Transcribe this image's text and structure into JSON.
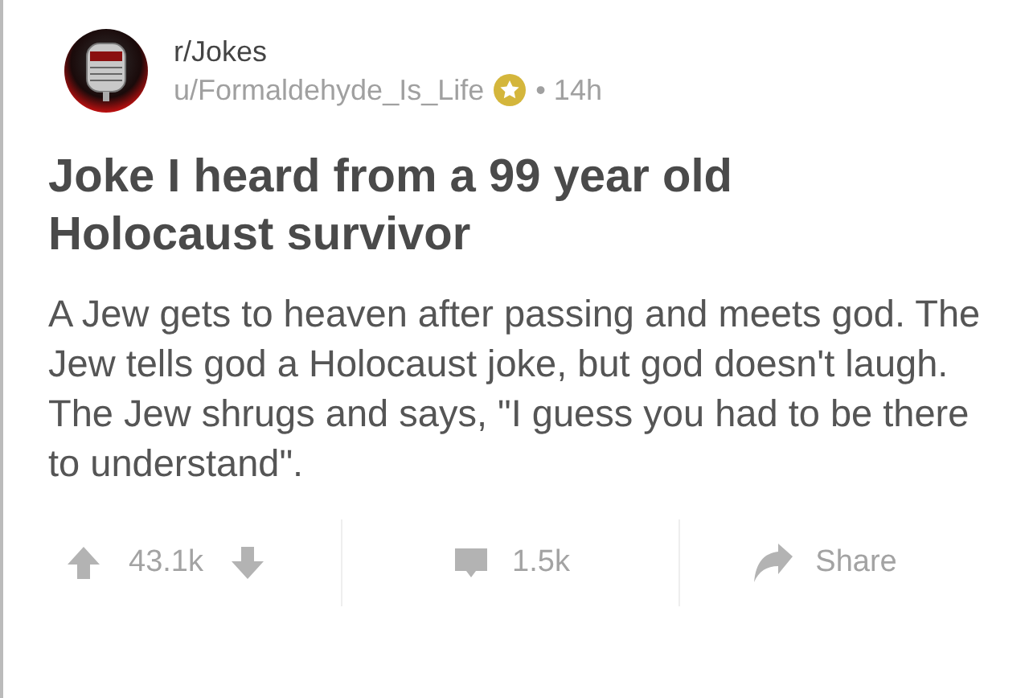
{
  "post": {
    "subreddit": "r/Jokes",
    "author": "u/Formaldehyde_Is_Life",
    "time": "• 14h",
    "title": "Joke I heard from a 99 year old Holocaust survivor",
    "body": "A Jew gets to heaven after passing and meets god. The Jew tells god a Holocaust joke, but god doesn't laugh. The Jew shrugs and says, \"I guess you had to be there to understand\".",
    "votes": "43.1k",
    "comments": "1.5k",
    "share": "Share"
  }
}
